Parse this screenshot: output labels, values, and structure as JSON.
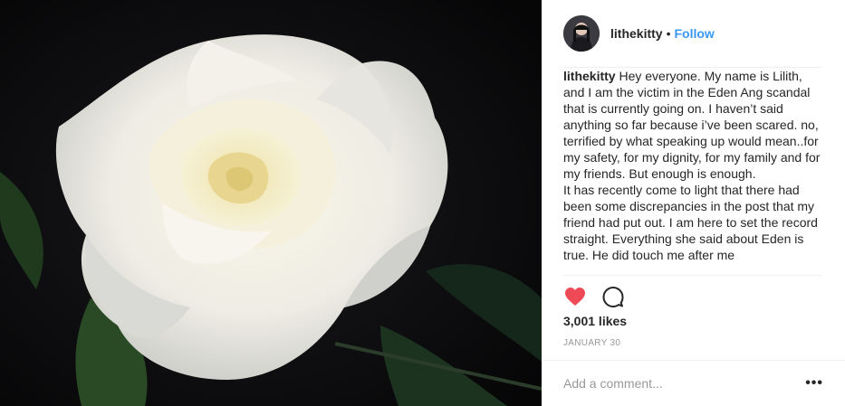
{
  "post": {
    "image_alt": "white rose",
    "username": "lithekitty",
    "separator": "•",
    "follow_label": "Follow",
    "caption_user": "lithekitty",
    "caption_text": " Hey everyone. My name is Lilith, and I am the victim in the Eden Ang scandal that is currently going on. I haven’t said anything so far because i’ve been scared. no, terrified by what speaking up would mean..for my safety, for my dignity, for my family and for my friends. But enough is enough.\nIt has recently come to light that there had been some discrepancies in the post that my friend had put out. I am here to set the record straight. Everything she said about Eden is true. He did touch me after me",
    "likes": "3,001 likes",
    "date": "JANUARY 30",
    "comment_placeholder": "Add a comment...",
    "more_label": "•••"
  },
  "icons": {
    "like": "heart-icon",
    "comment": "comment-icon"
  },
  "colors": {
    "like_red": "#ed4956",
    "follow_blue": "#3897f0",
    "photo_bg": "#0b0b0d"
  }
}
